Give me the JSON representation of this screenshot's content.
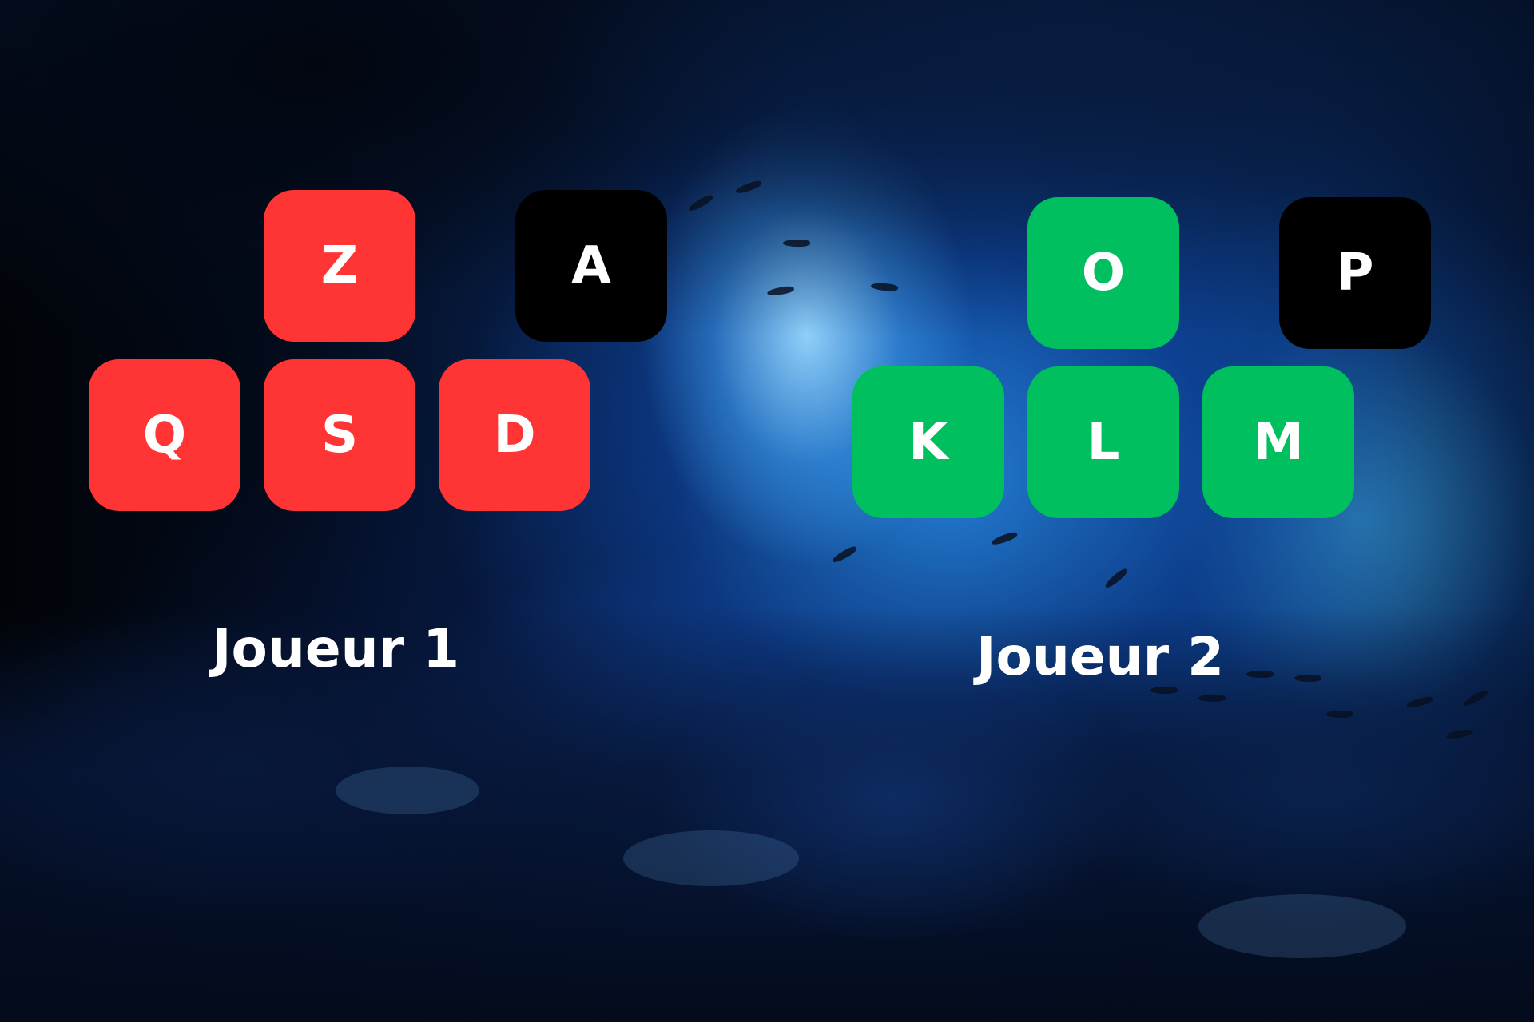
{
  "player1": {
    "label": "Joueur 1",
    "color": "#ff3434",
    "keys": {
      "up": "Z",
      "left": "Q",
      "down": "S",
      "right": "D",
      "action": "A"
    }
  },
  "player2": {
    "label": "Joueur 2",
    "color": "#00bf5f",
    "keys": {
      "up": "O",
      "left": "K",
      "down": "L",
      "right": "M",
      "action": "P"
    }
  },
  "action_key_color": "#000000",
  "background": "underwater-cave-image"
}
